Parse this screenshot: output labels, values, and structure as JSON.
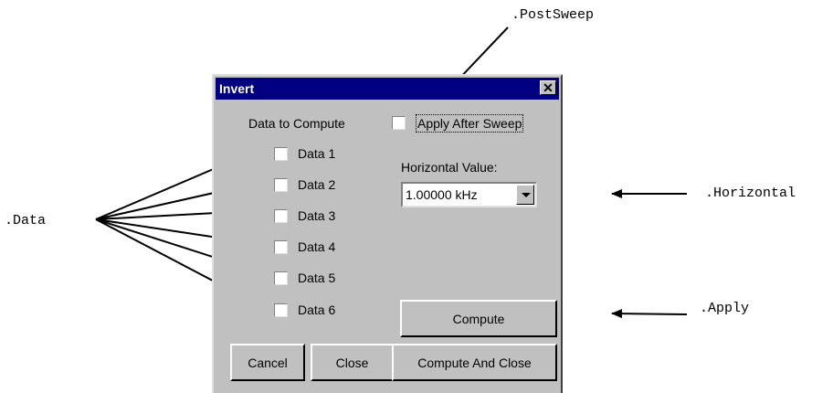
{
  "annotations": {
    "post_sweep": ".PostSweep",
    "data": ".Data",
    "horizontal": ".Horizontal",
    "apply": ".Apply"
  },
  "dialog": {
    "title": "Invert",
    "close_glyph": "✕",
    "data_to_compute_label": "Data to Compute",
    "apply_after_sweep_label": "Apply After Sweep",
    "data_items": [
      "Data 1",
      "Data 2",
      "Data 3",
      "Data 4",
      "Data 5",
      "Data 6"
    ],
    "horizontal_value_label": "Horizontal Value:",
    "horizontal_value": "1.00000 kHz",
    "buttons": {
      "compute": "Compute",
      "cancel": "Cancel",
      "close": "Close",
      "compute_and_close": "Compute And Close"
    }
  }
}
